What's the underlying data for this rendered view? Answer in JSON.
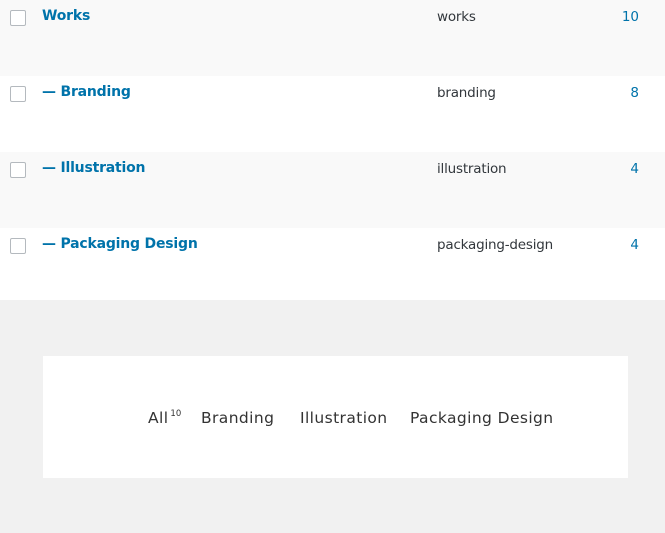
{
  "rows": [
    {
      "name": "Works",
      "slug": "works",
      "count": "10"
    },
    {
      "name": "— Branding",
      "slug": "branding",
      "count": "8"
    },
    {
      "name": "— Illustration",
      "slug": "illustration",
      "count": "4"
    },
    {
      "name": "— Packaging Design",
      "slug": "packaging-design",
      "count": "4"
    }
  ],
  "filter": {
    "all_label": "All",
    "all_count": "10",
    "items": [
      "Branding",
      "Illustration",
      "Packaging Design"
    ]
  }
}
